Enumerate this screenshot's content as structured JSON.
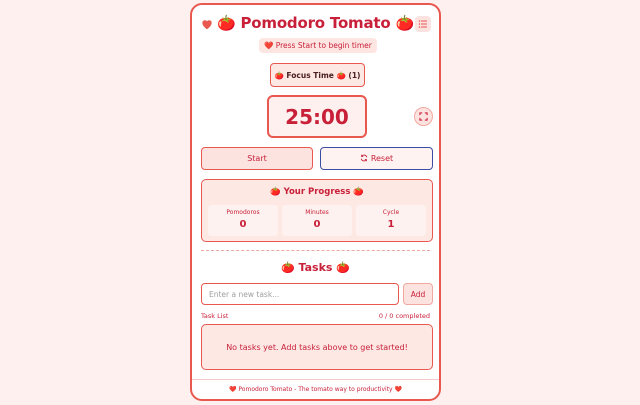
{
  "header": {
    "title": "🍅 Pomodoro Tomato 🍅",
    "heart_icon": "heart-icon",
    "menu_icon": "list-icon"
  },
  "status": {
    "text": "❤️ Press Start to begin timer"
  },
  "mode": {
    "label": "🍅 Focus Time 🍅 (1)"
  },
  "timer": {
    "display": "25:00"
  },
  "controls": {
    "start_label": "Start",
    "reset_label": "Reset",
    "fullscreen_icon": "fullscreen-icon"
  },
  "progress": {
    "title": "🍅 Your Progress 🍅",
    "stats": [
      {
        "label": "Pomodoros",
        "value": "0"
      },
      {
        "label": "Minutes",
        "value": "0"
      },
      {
        "label": "Cycle",
        "value": "1"
      }
    ]
  },
  "tasks": {
    "title": "🍅 Tasks 🍅",
    "input_placeholder": "Enter a new task...",
    "add_label": "Add",
    "list_label": "Task List",
    "completed_count": "0 / 0 completed",
    "empty_message": "No tasks yet. Add tasks above to get started!"
  },
  "footer": {
    "text": "❤️ Pomodoro Tomato - The tomato way to productivity ❤️"
  },
  "colors": {
    "accent": "#e8584f",
    "text": "#c9203a",
    "reset_border": "#3c4ea3",
    "background": "#fdf0ee"
  }
}
